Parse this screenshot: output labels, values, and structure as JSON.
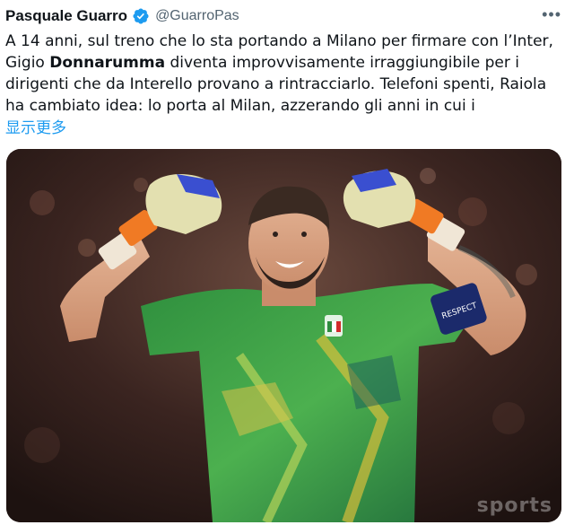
{
  "tweet": {
    "author_name": "Pasquale Guarro",
    "handle": "@GuarroPas",
    "more_icon": "more-horizontal-icon",
    "text_part1": "A 14 anni, sul treno che lo sta portando a Milano per firmare con l’Inter, Gigio ",
    "text_bold": "Donnarumma",
    "text_part2": " diventa improvvisamente irraggiungibile per i dirigenti che da Interello provano a rintracciarlo. Telefoni spenti, Raiola ha cambiato idea: lo porta al Milan, azzerando gli anni in cui i",
    "show_more": "显示更多",
    "verified_icon": "verified-badge-icon"
  },
  "media": {
    "kind": "photo",
    "armband_text": "RESPECT",
    "watermark": "sports"
  },
  "colors": {
    "link": "#1d9bf0",
    "verified": "#1d9bf0",
    "secondary_text": "#536471"
  }
}
